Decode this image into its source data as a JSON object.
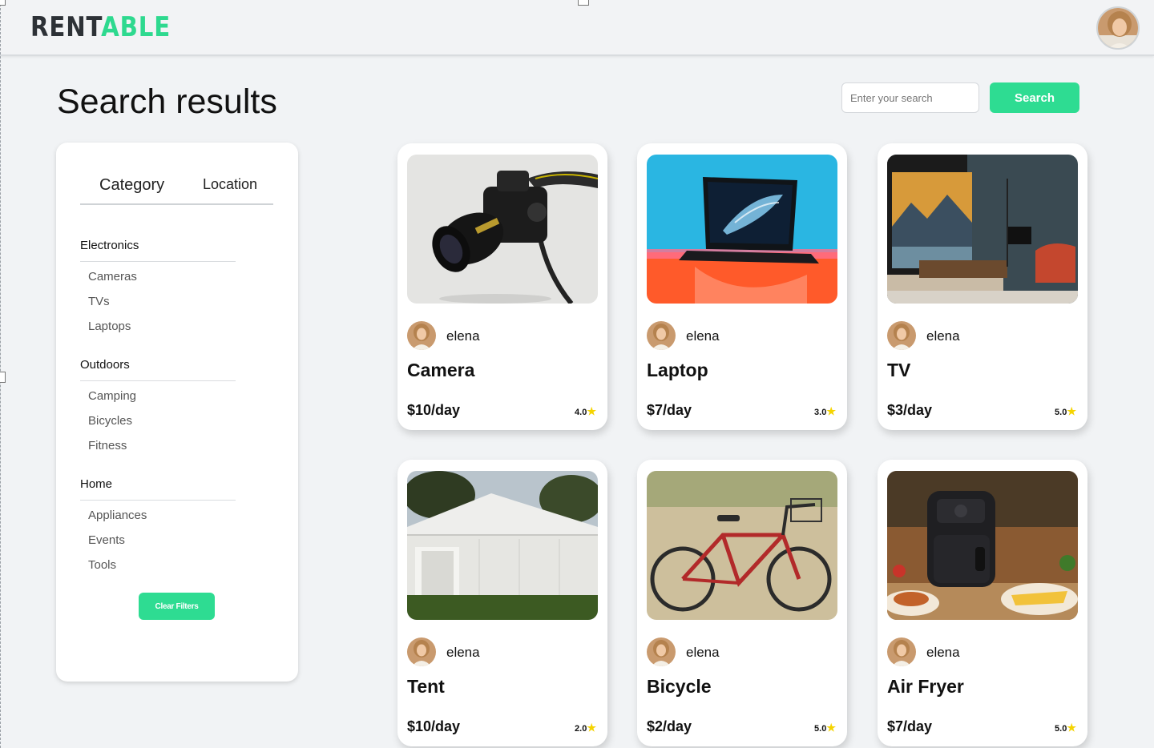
{
  "app": {
    "logo_part1": "RENT",
    "logo_part2": "ABLE"
  },
  "colors": {
    "accent": "#2edc92",
    "logo_dark": "#2d3136",
    "star": "#f5d400"
  },
  "page": {
    "title": "Search results"
  },
  "search": {
    "placeholder": "Enter your search",
    "button_label": "Search"
  },
  "filters": {
    "tabs": [
      "Category",
      "Location"
    ],
    "groups": [
      {
        "title": "Electronics",
        "items": [
          "Cameras",
          "TVs",
          "Laptops"
        ]
      },
      {
        "title": "Outdoors",
        "items": [
          "Camping",
          "Bicycles",
          "Fitness"
        ]
      },
      {
        "title": "Home",
        "items": [
          "Appliances",
          "Events",
          "Tools"
        ]
      }
    ],
    "clear_label": "Clear Filters"
  },
  "listings": [
    {
      "title": "Camera",
      "owner": "elena",
      "price": "$10/day",
      "rating": "4.0",
      "image": "camera-photo"
    },
    {
      "title": "Laptop",
      "owner": "elena",
      "price": "$7/day",
      "rating": "3.0",
      "image": "laptop-photo"
    },
    {
      "title": "TV",
      "owner": "elena",
      "price": "$3/day",
      "rating": "5.0",
      "image": "tv-photo"
    },
    {
      "title": "Tent",
      "owner": "elena",
      "price": "$10/day",
      "rating": "2.0",
      "image": "tent-photo"
    },
    {
      "title": "Bicycle",
      "owner": "elena",
      "price": "$2/day",
      "rating": "5.0",
      "image": "bicycle-photo"
    },
    {
      "title": "Air Fryer",
      "owner": "elena",
      "price": "$7/day",
      "rating": "5.0",
      "image": "air-fryer-photo"
    }
  ],
  "icons": {
    "star": "star-icon"
  }
}
